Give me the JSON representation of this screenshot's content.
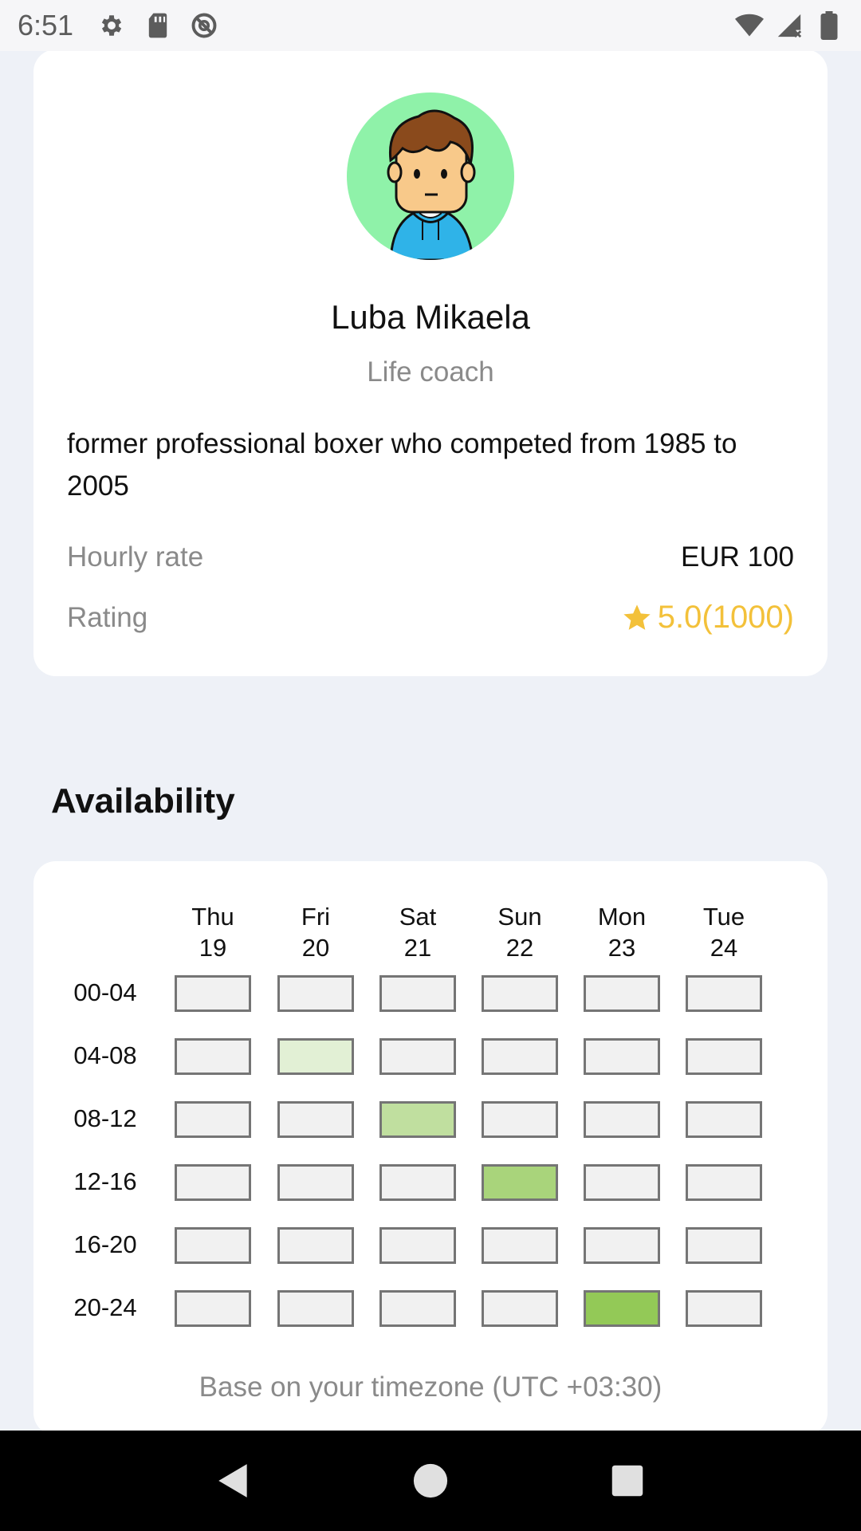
{
  "status_bar": {
    "time": "6:51",
    "left_icons": [
      "gear-icon",
      "sd-card-icon",
      "no-sync-icon"
    ],
    "right_icons": [
      "wifi-icon",
      "signal-icon",
      "battery-icon"
    ]
  },
  "profile": {
    "name": "Luba Mikaela",
    "role": "Life coach",
    "bio": "former professional boxer who competed from 1985 to 2005",
    "hourly_rate_label": "Hourly rate",
    "hourly_rate_value": "EUR 100",
    "rating_label": "Rating",
    "rating_value": "5.0(1000)",
    "avatar_bg": "#8ff2a9",
    "rating_color": "#f3c13a"
  },
  "availability": {
    "title": "Availability",
    "days": [
      {
        "name": "Thu",
        "date": "19"
      },
      {
        "name": "Fri",
        "date": "20"
      },
      {
        "name": "Sat",
        "date": "21"
      },
      {
        "name": "Sun",
        "date": "22"
      },
      {
        "name": "Mon",
        "date": "23"
      },
      {
        "name": "Tue",
        "date": "24"
      }
    ],
    "slots": [
      "00-04",
      "04-08",
      "08-12",
      "12-16",
      "16-20",
      "20-24"
    ],
    "levels": [
      [
        0,
        0,
        0,
        0,
        0,
        0
      ],
      [
        0,
        1,
        0,
        0,
        0,
        0
      ],
      [
        0,
        0,
        2,
        0,
        0,
        0
      ],
      [
        0,
        0,
        0,
        3,
        0,
        0
      ],
      [
        0,
        0,
        0,
        0,
        0,
        0
      ],
      [
        0,
        0,
        0,
        0,
        4,
        0
      ]
    ],
    "level_colors": [
      "#f1f1f1",
      "#e2f0d5",
      "#c0df9f",
      "#a9d47b",
      "#93c957"
    ],
    "timezone_note": "Base on your timezone (UTC +03:30)"
  },
  "nav_bar": {
    "buttons": [
      "back-icon",
      "home-icon",
      "recents-icon"
    ]
  }
}
